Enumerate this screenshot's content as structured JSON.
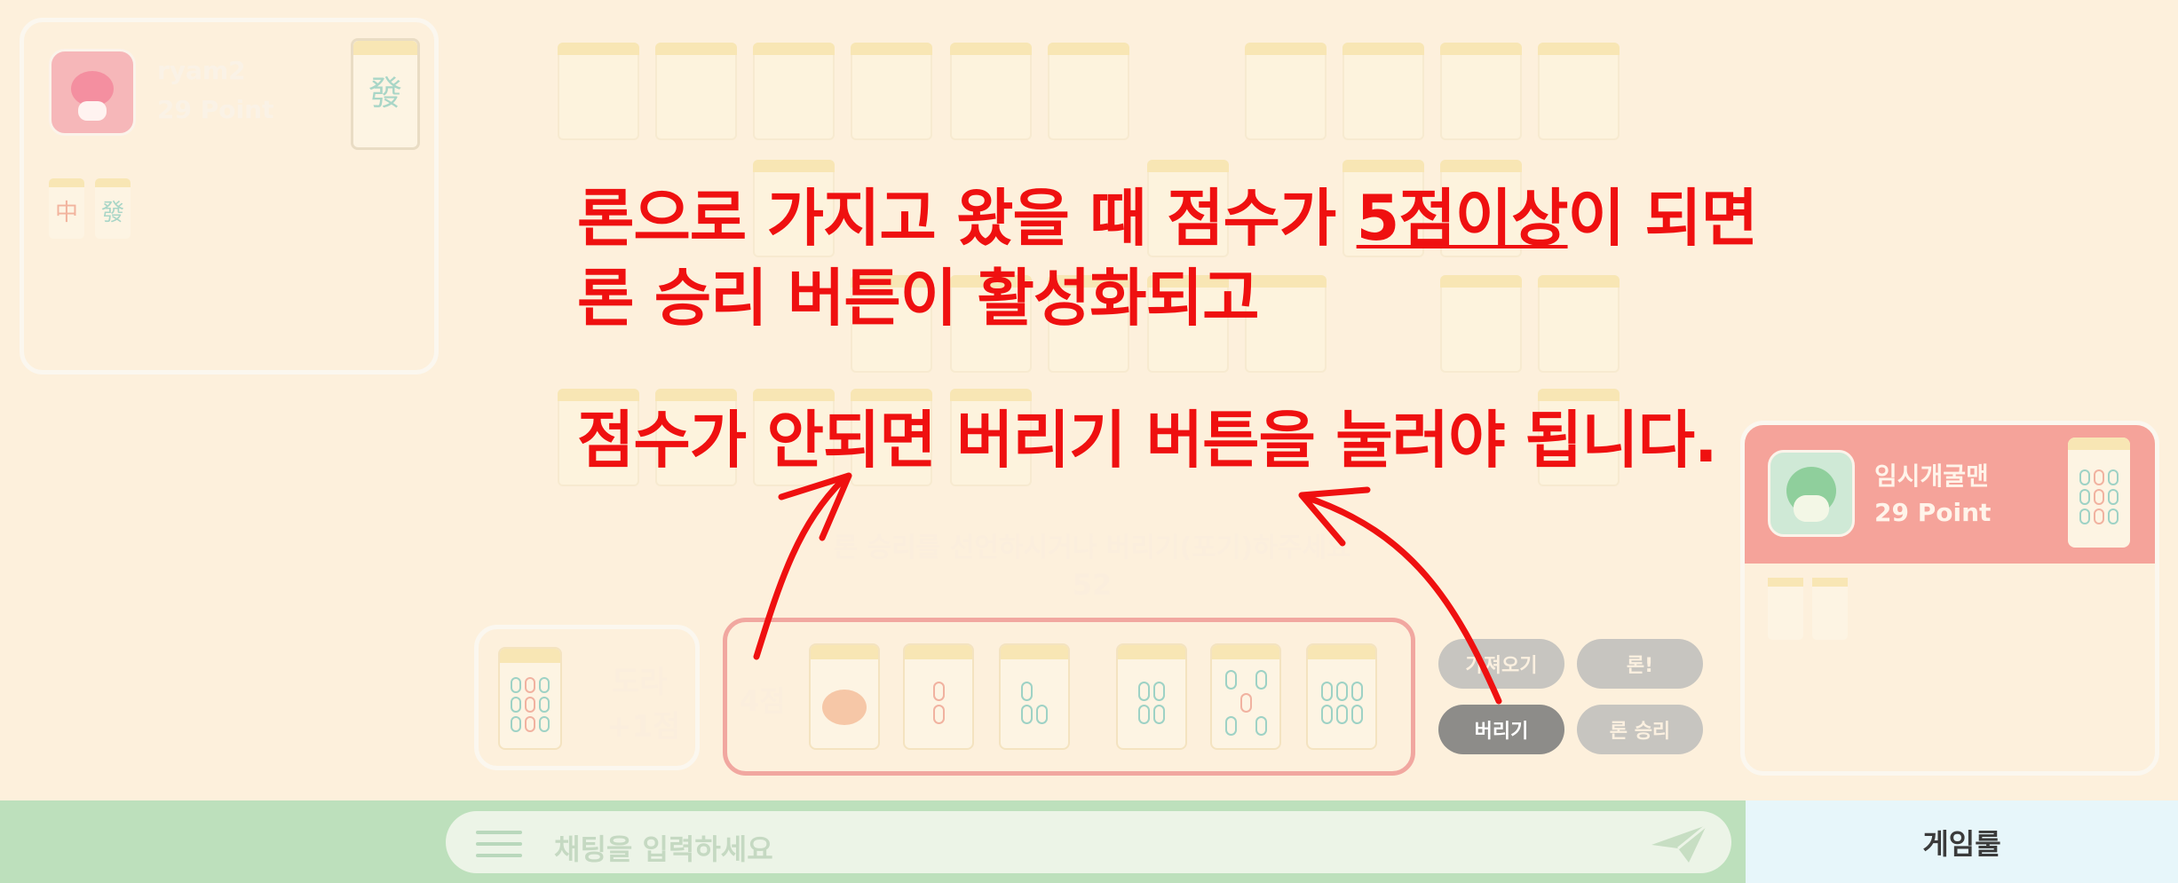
{
  "colors": {
    "background": "#fdf0dc",
    "annotation_red": "#ef1010",
    "chat_bar_green": "#bde0bc",
    "rules_button_bg": "#e7f6fa",
    "active_player_panel": "#f5a39a"
  },
  "player_top": {
    "name": "ryam2",
    "points": "29 Point",
    "melds": [
      "中",
      "發"
    ],
    "hand_tile": "發"
  },
  "player_right": {
    "name": "임시개굴맨",
    "points": "29 Point"
  },
  "annotation": {
    "line1_pre": "론으로 가지고 왔을 때 점수가 ",
    "line1_underlined": "5점이상",
    "line1_post": "이 되면",
    "line2": "론 승리 버튼이 활성화되고",
    "line3": "점수가 안되면 버리기 버튼을 눌러야 됩니다."
  },
  "status": {
    "message": "론 승리를 선언하시거나 버리기(포기)하주세요",
    "timer": "52"
  },
  "dora": {
    "label": "도라",
    "bonus": "+1점"
  },
  "hand": {
    "score": "4점"
  },
  "actions": {
    "draw": "가져오기",
    "ron": "론!",
    "discard": "버리기",
    "ron_win": "론 승리"
  },
  "chat": {
    "placeholder": "채팅을 입력하세요",
    "menu_icon": "menu-icon",
    "send_icon": "send-icon"
  },
  "rules_button": "게임룰"
}
